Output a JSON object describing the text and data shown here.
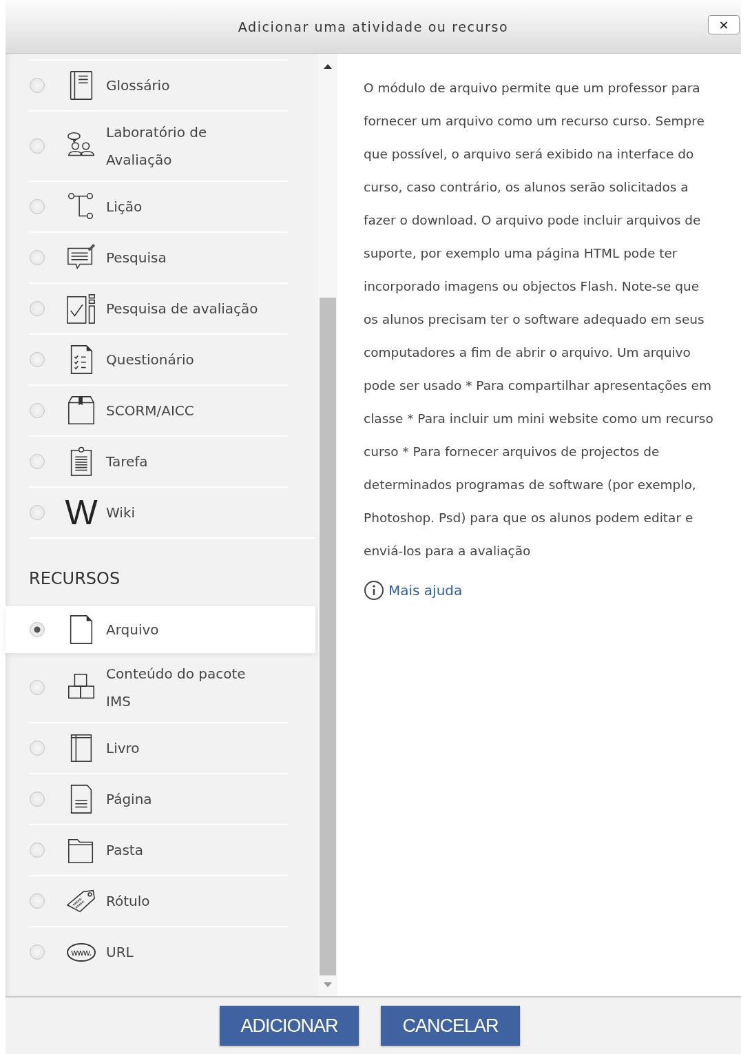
{
  "dialog": {
    "title": "Adicionar uma atividade ou recurso",
    "close": "✕"
  },
  "sections": [
    {
      "items": [
        {
          "kind": "glossary",
          "label": "Glossário",
          "selected": false
        },
        {
          "kind": "workshop",
          "label": "Laboratório de Avaliação",
          "selected": false
        },
        {
          "kind": "lesson",
          "label": "Lição",
          "selected": false
        },
        {
          "kind": "survey",
          "label": "Pesquisa",
          "selected": false
        },
        {
          "kind": "feedback",
          "label": "Pesquisa de avaliação",
          "selected": false
        },
        {
          "kind": "quiz",
          "label": "Questionário",
          "selected": false
        },
        {
          "kind": "package",
          "label": "SCORM/AICC",
          "selected": false
        },
        {
          "kind": "assignment",
          "label": "Tarefa",
          "selected": false
        },
        {
          "kind": "letter",
          "icon_text": "W",
          "label": "Wiki",
          "selected": false
        }
      ]
    },
    {
      "heading": "RECURSOS",
      "items": [
        {
          "kind": "file",
          "label": "Arquivo",
          "selected": true
        },
        {
          "kind": "blocks",
          "label": "Conteúdo do pacote IMS",
          "selected": false
        },
        {
          "kind": "book",
          "label": "Livro",
          "selected": false
        },
        {
          "kind": "page",
          "label": "Página",
          "selected": false
        },
        {
          "kind": "folder",
          "label": "Pasta",
          "selected": false
        },
        {
          "kind": "tag",
          "label": "Rótulo",
          "selected": false
        },
        {
          "kind": "web",
          "icon_text": "www.",
          "label": "URL",
          "selected": false
        }
      ]
    }
  ],
  "description": "O módulo de arquivo permite que um professor para fornecer um arquivo como um recurso curso. Sempre que possível, o arquivo será exibido na interface do curso, caso contrário, os alunos serão solicitados a fazer o download. O arquivo pode incluir arquivos de suporte, por exemplo uma página HTML pode ter incorporado imagens ou objectos Flash. Note-se que os alunos precisam ter o software adequado em seus computadores a fim de abrir o arquivo. Um arquivo pode ser usado * Para compartilhar apresentações em classe * Para incluir um mini website como um recurso curso * Para fornecer arquivos de projectos de determinados programas de software (por exemplo, Photoshop. Psd) para que os alunos podem editar e enviá-los para a avaliação",
  "help_link": "Mais ajuda",
  "buttons": [
    "ADICIONAR",
    "CANCELAR"
  ]
}
